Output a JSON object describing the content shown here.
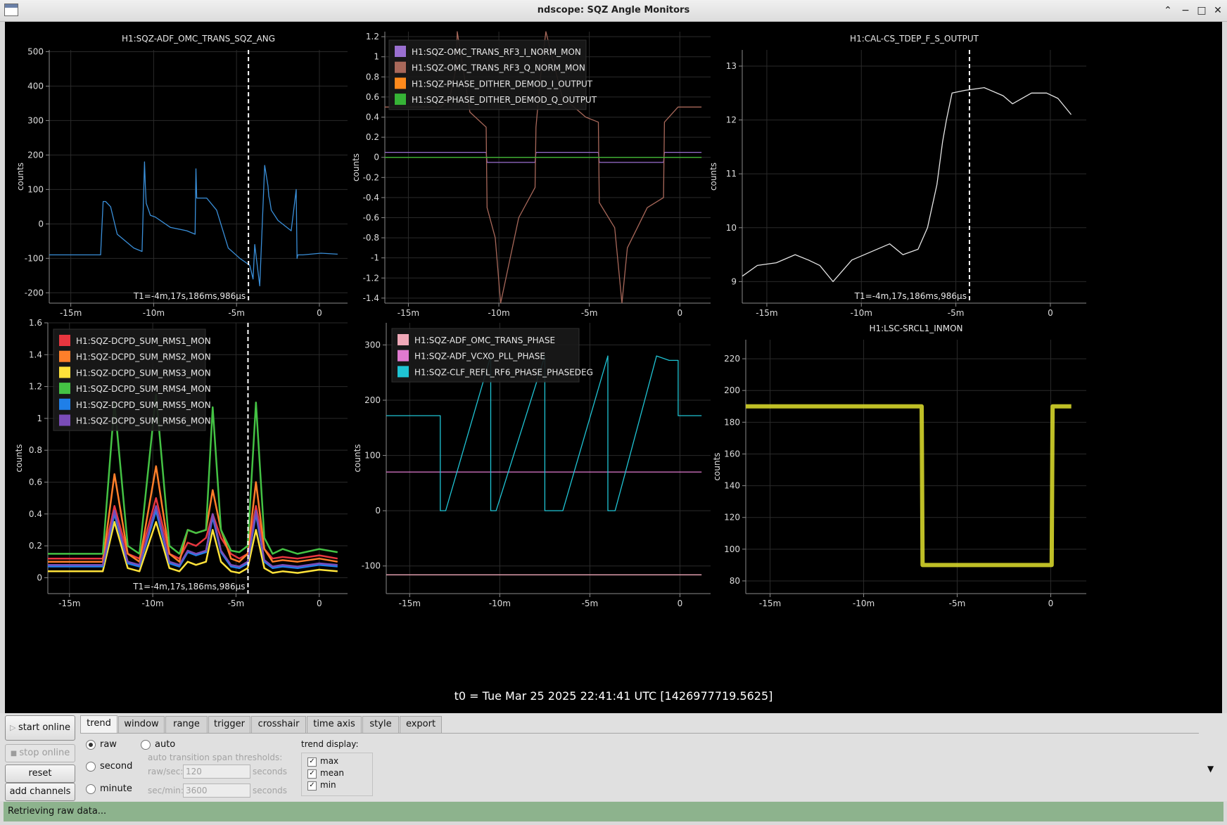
{
  "window": {
    "title": "ndscope: SQZ Angle Monitors"
  },
  "colors": {
    "bg": "#000000",
    "grid": "#2a2a2a",
    "axis": "#8a8a8a",
    "cursor": "#ffffff"
  },
  "t0": "t0 = Tue Mar 25 2025 22:41:41 UTC [1426977719.5625]",
  "cursor_label": "T1=-4m,17s,186ms,986µs",
  "plots": [
    {
      "id": "p1",
      "title": "H1:SQZ-ADF_OMC_TRANS_SQZ_ANG",
      "ylabel": "counts",
      "yticks": [
        "500",
        "400",
        "300",
        "200",
        "100",
        "0",
        "-100",
        "-200"
      ],
      "xticks": [
        "-15m",
        "-10m",
        "-5m",
        "0"
      ],
      "legend": [],
      "cursor_label": "T1=-4m,17s,186ms,986µs"
    },
    {
      "id": "p2",
      "title": "",
      "ylabel": "counts",
      "yticks": [
        "1.2",
        "1",
        "0.8",
        "0.6",
        "0.4",
        "0.2",
        "0",
        "-0.2",
        "-0.4",
        "-0.6",
        "-0.8",
        "-1",
        "-1.2",
        "-1.4"
      ],
      "xticks": [
        "-15m",
        "-10m",
        "-5m",
        "0"
      ],
      "legend": [
        {
          "name": "H1:SQZ-OMC_TRANS_RF3_I_NORM_MON",
          "color": "#9a6fd0"
        },
        {
          "name": "H1:SQZ-OMC_TRANS_RF3_Q_NORM_MON",
          "color": "#a8685a"
        },
        {
          "name": "H1:SQZ-PHASE_DITHER_DEMOD_I_OUTPUT",
          "color": "#ff8a1c"
        },
        {
          "name": "H1:SQZ-PHASE_DITHER_DEMOD_Q_OUTPUT",
          "color": "#36b336"
        }
      ],
      "cursor_label": ""
    },
    {
      "id": "p3",
      "title": "H1:CAL-CS_TDEP_F_S_OUTPUT",
      "ylabel": "counts",
      "yticks": [
        "13",
        "12",
        "11",
        "10",
        "9"
      ],
      "xticks": [
        "-15m",
        "-10m",
        "-5m",
        "0"
      ],
      "legend": [],
      "cursor_label": "T1=-4m,17s,186ms,986µs"
    },
    {
      "id": "p4",
      "title": "",
      "ylabel": "counts",
      "yticks": [
        "1.6",
        "1.4",
        "1.2",
        "1",
        "0.8",
        "0.6",
        "0.4",
        "0.2",
        "0"
      ],
      "xticks": [
        "-15m",
        "-10m",
        "-5m",
        "0"
      ],
      "legend": [
        {
          "name": "H1:SQZ-DCPD_SUM_RMS1_MON",
          "color": "#e8363f"
        },
        {
          "name": "H1:SQZ-DCPD_SUM_RMS2_MON",
          "color": "#ff7f2a"
        },
        {
          "name": "H1:SQZ-DCPD_SUM_RMS3_MON",
          "color": "#ffe23a"
        },
        {
          "name": "H1:SQZ-DCPD_SUM_RMS4_MON",
          "color": "#44c244"
        },
        {
          "name": "H1:SQZ-DCPD_SUM_RMS5_MON",
          "color": "#1f7fe8"
        },
        {
          "name": "H1:SQZ-DCPD_SUM_RMS6_MON",
          "color": "#7a4cb8"
        }
      ],
      "cursor_label": "T1=-4m,17s,186ms,986µs"
    },
    {
      "id": "p5",
      "title": "",
      "ylabel": "counts",
      "yticks": [
        "300",
        "200",
        "100",
        "0",
        "-100"
      ],
      "xticks": [
        "-15m",
        "-10m",
        "-5m",
        "0"
      ],
      "legend": [
        {
          "name": "H1:SQZ-ADF_OMC_TRANS_PHASE",
          "color": "#f0a8b8"
        },
        {
          "name": "H1:SQZ-ADF_VCXO_PLL_PHASE",
          "color": "#e07ad0"
        },
        {
          "name": "H1:SQZ-CLF_REFL_RF6_PHASE_PHASEDEG",
          "color": "#1fc4d4"
        }
      ],
      "cursor_label": ""
    },
    {
      "id": "p6",
      "title": "H1:LSC-SRCL1_INMON",
      "ylabel": "counts",
      "yticks": [
        "220",
        "200",
        "180",
        "160",
        "140",
        "120",
        "100",
        "80"
      ],
      "xticks": [
        "-15m",
        "-10m",
        "-5m",
        "0"
      ],
      "legend": [],
      "cursor_label": ""
    }
  ],
  "chart_data": [
    {
      "type": "line",
      "title": "H1:SQZ-ADF_OMC_TRANS_SQZ_ANG",
      "ylabel": "counts",
      "xlabel": "",
      "xlim": [
        -16.3,
        1.7
      ],
      "ylim": [
        -230,
        505
      ],
      "series": [
        {
          "color": "#3a8fd9",
          "x": [
            -16.3,
            -13.2,
            -13.05,
            -12.9,
            -12.6,
            -12.2,
            -11.2,
            -10.7,
            -10.55,
            -10.5,
            -10.45,
            -10.3,
            -10.2,
            -9.9,
            -9.0,
            -8.0,
            -7.5,
            -7.45,
            -7.4,
            -7.3,
            -6.8,
            -6.2,
            -5.5,
            -4.8,
            -4.2,
            -4.0,
            -3.9,
            -3.8,
            -3.6,
            -3.3,
            -3.1,
            -3.05,
            -3.0,
            -2.9,
            -2.5,
            -1.7,
            -1.4,
            -1.35,
            -1.3,
            -1.0,
            0.1,
            1.1
          ],
          "y": [
            -90,
            -90,
            65,
            65,
            50,
            -30,
            -70,
            -80,
            180,
            110,
            60,
            40,
            25,
            20,
            -10,
            -20,
            -30,
            160,
            75,
            75,
            75,
            40,
            -70,
            -100,
            -120,
            -160,
            -60,
            -100,
            -180,
            170,
            110,
            80,
            70,
            40,
            10,
            -20,
            100,
            -100,
            -90,
            -90,
            -85,
            -88
          ]
        }
      ]
    },
    {
      "type": "line",
      "title": "",
      "ylabel": "counts",
      "xlabel": "",
      "xlim": [
        -16.3,
        1.7
      ],
      "ylim": [
        -1.45,
        1.25
      ],
      "series": [
        {
          "name": "H1:SQZ-OMC_TRANS_RF3_I_NORM_MON",
          "color": "#9a6fd0",
          "x": [
            -16.3,
            -10.7,
            -10.65,
            -8.0,
            -7.95,
            -4.5,
            -4.45,
            -0.9,
            -0.85,
            1.2
          ],
          "y": [
            0.05,
            0.05,
            -0.05,
            -0.05,
            0.05,
            0.05,
            -0.05,
            -0.05,
            0.05,
            0.05
          ]
        },
        {
          "name": "H1:SQZ-OMC_TRANS_RF3_Q_NORM_MON",
          "color": "#a8685a",
          "x": [
            -16.3,
            -13.2,
            -12.7,
            -12.35,
            -12.3,
            -11.6,
            -10.7,
            -10.65,
            -10.2,
            -9.9,
            -8.9,
            -8.0,
            -7.95,
            -7.7,
            -7.4,
            -6.5,
            -5.2,
            -4.5,
            -4.45,
            -3.6,
            -3.2,
            -2.9,
            -1.8,
            -0.9,
            -0.85,
            -0.1,
            1.2
          ],
          "y": [
            0.5,
            0.5,
            0.6,
            0.9,
            1.25,
            0.45,
            0.3,
            -0.5,
            -0.8,
            -1.45,
            -0.6,
            -0.3,
            0.3,
            0.8,
            1.25,
            0.6,
            0.4,
            0.35,
            -0.45,
            -0.7,
            -1.45,
            -0.9,
            -0.5,
            -0.4,
            0.35,
            0.5,
            0.5
          ]
        },
        {
          "name": "H1:SQZ-PHASE_DITHER_DEMOD_I_OUTPUT",
          "color": "#ff8a1c",
          "x": [
            -16.3,
            1.2
          ],
          "y": [
            0,
            0
          ]
        },
        {
          "name": "H1:SQZ-PHASE_DITHER_DEMOD_Q_OUTPUT",
          "color": "#36b336",
          "x": [
            -16.3,
            1.2
          ],
          "y": [
            0,
            0
          ]
        }
      ]
    },
    {
      "type": "line",
      "title": "H1:CAL-CS_TDEP_F_S_OUTPUT",
      "ylabel": "counts",
      "xlabel": "",
      "xlim": [
        -16.3,
        1.9
      ],
      "ylim": [
        8.6,
        13.3
      ],
      "series": [
        {
          "color": "#e6e6e6",
          "x": [
            -16.3,
            -15.5,
            -14.5,
            -13.5,
            -12.8,
            -12.2,
            -11.5,
            -10.5,
            -9.5,
            -8.5,
            -7.8,
            -7.0,
            -6.5,
            -6.0,
            -5.7,
            -5.5,
            -5.2,
            -4.5,
            -3.5,
            -2.5,
            -2.0,
            -1.0,
            -0.2,
            0.4,
            1.1
          ],
          "y": [
            9.1,
            9.3,
            9.35,
            9.5,
            9.4,
            9.3,
            9.0,
            9.4,
            9.55,
            9.7,
            9.5,
            9.6,
            10.0,
            10.8,
            11.6,
            12.0,
            12.5,
            12.55,
            12.6,
            12.45,
            12.3,
            12.5,
            12.5,
            12.4,
            12.1
          ]
        }
      ]
    },
    {
      "type": "line",
      "title": "",
      "ylabel": "counts",
      "xlabel": "",
      "xlim": [
        -16.3,
        1.7
      ],
      "ylim": [
        -0.1,
        1.6
      ],
      "series": [
        {
          "name": "H1:SQZ-DCPD_SUM_RMS1_MON",
          "color": "#e8363f",
          "x": [
            -16.3,
            -13,
            -12.3,
            -11.5,
            -10.8,
            -9.8,
            -9.0,
            -8.4,
            -7.9,
            -7.4,
            -6.8,
            -6.4,
            -5.9,
            -5.3,
            -4.8,
            -4.3,
            -3.8,
            -3.3,
            -2.8,
            -2.2,
            -1.3,
            0,
            1.1
          ],
          "y": [
            0.12,
            0.12,
            0.45,
            0.15,
            0.12,
            0.5,
            0.15,
            0.12,
            0.22,
            0.2,
            0.25,
            0.4,
            0.25,
            0.15,
            0.12,
            0.15,
            0.45,
            0.18,
            0.12,
            0.13,
            0.12,
            0.14,
            0.12
          ]
        },
        {
          "name": "H1:SQZ-DCPD_SUM_RMS2_MON",
          "color": "#ff7f2a",
          "x": [
            -16.3,
            -13,
            -12.3,
            -11.5,
            -10.8,
            -9.8,
            -9.0,
            -8.4,
            -7.9,
            -7.4,
            -6.8,
            -6.4,
            -5.9,
            -5.3,
            -4.8,
            -4.3,
            -3.8,
            -3.3,
            -2.8,
            -2.2,
            -1.3,
            0,
            1.1
          ],
          "y": [
            0.1,
            0.1,
            0.65,
            0.15,
            0.1,
            0.7,
            0.15,
            0.1,
            0.3,
            0.28,
            0.3,
            0.55,
            0.3,
            0.12,
            0.1,
            0.15,
            0.6,
            0.18,
            0.1,
            0.11,
            0.1,
            0.12,
            0.1
          ]
        },
        {
          "name": "H1:SQZ-DCPD_SUM_RMS3_MON",
          "color": "#ffe23a",
          "x": [
            -16.3,
            -13,
            -12.3,
            -11.5,
            -10.8,
            -9.8,
            -9.0,
            -8.4,
            -7.9,
            -7.4,
            -6.8,
            -6.4,
            -5.9,
            -5.3,
            -4.8,
            -4.3,
            -3.8,
            -3.3,
            -2.8,
            -2.2,
            -1.3,
            0,
            1.1
          ],
          "y": [
            0.04,
            0.04,
            0.35,
            0.06,
            0.04,
            0.35,
            0.06,
            0.04,
            0.1,
            0.08,
            0.1,
            0.3,
            0.1,
            0.04,
            0.03,
            0.06,
            0.3,
            0.06,
            0.03,
            0.04,
            0.03,
            0.05,
            0.04
          ]
        },
        {
          "name": "H1:SQZ-DCPD_SUM_RMS4_MON",
          "color": "#44c244",
          "x": [
            -16.3,
            -13,
            -12.3,
            -11.5,
            -10.8,
            -9.8,
            -9.0,
            -8.4,
            -7.9,
            -7.4,
            -6.8,
            -6.4,
            -5.9,
            -5.3,
            -4.8,
            -4.3,
            -3.8,
            -3.3,
            -2.8,
            -2.2,
            -1.3,
            0,
            1.1
          ],
          "y": [
            0.15,
            0.15,
            1.1,
            0.2,
            0.15,
            1.15,
            0.2,
            0.15,
            0.3,
            0.28,
            0.3,
            1.07,
            0.3,
            0.17,
            0.16,
            0.2,
            1.1,
            0.25,
            0.15,
            0.18,
            0.15,
            0.18,
            0.16
          ]
        },
        {
          "name": "H1:SQZ-DCPD_SUM_RMS5_MON",
          "color": "#1f7fe8",
          "x": [
            -16.3,
            -13,
            -12.3,
            -11.5,
            -10.8,
            -9.8,
            -9.0,
            -8.4,
            -7.9,
            -7.4,
            -6.8,
            -6.4,
            -5.9,
            -5.3,
            -4.8,
            -4.3,
            -3.8,
            -3.3,
            -2.8,
            -2.2,
            -1.3,
            0,
            1.1
          ],
          "y": [
            0.07,
            0.07,
            0.4,
            0.09,
            0.07,
            0.42,
            0.09,
            0.07,
            0.16,
            0.14,
            0.16,
            0.38,
            0.16,
            0.07,
            0.06,
            0.09,
            0.4,
            0.1,
            0.06,
            0.07,
            0.06,
            0.08,
            0.07
          ]
        },
        {
          "name": "H1:SQZ-DCPD_SUM_RMS6_MON",
          "color": "#7a4cb8",
          "x": [
            -16.3,
            -13,
            -12.3,
            -11.5,
            -10.8,
            -9.8,
            -9.0,
            -8.4,
            -7.9,
            -7.4,
            -6.8,
            -6.4,
            -5.9,
            -5.3,
            -4.8,
            -4.3,
            -3.8,
            -3.3,
            -2.8,
            -2.2,
            -1.3,
            0,
            1.1
          ],
          "y": [
            0.08,
            0.08,
            0.42,
            0.1,
            0.08,
            0.45,
            0.1,
            0.08,
            0.17,
            0.15,
            0.17,
            0.4,
            0.17,
            0.08,
            0.07,
            0.1,
            0.42,
            0.11,
            0.07,
            0.08,
            0.07,
            0.09,
            0.08
          ]
        }
      ]
    },
    {
      "type": "line",
      "title": "",
      "ylabel": "counts",
      "xlabel": "",
      "xlim": [
        -16.3,
        1.7
      ],
      "ylim": [
        -150,
        340
      ],
      "series": [
        {
          "name": "H1:SQZ-ADF_OMC_TRANS_PHASE",
          "color": "#f0a8b8",
          "x": [
            -16.3,
            1.2
          ],
          "y": [
            -116,
            -116
          ]
        },
        {
          "name": "H1:SQZ-ADF_VCXO_PLL_PHASE",
          "color": "#e07ad0",
          "x": [
            -16.3,
            1.2
          ],
          "y": [
            70,
            70
          ]
        },
        {
          "name": "H1:SQZ-CLF_REFL_RF6_PHASE_PHASEDEG",
          "color": "#1fc4d4",
          "x": [
            -16.3,
            -13.3,
            -13.3,
            -13.0,
            -10.5,
            -10.5,
            -10.2,
            -7.5,
            -7.5,
            -6.5,
            -4.0,
            -4.0,
            -3.6,
            -1.3,
            -0.6,
            -0.1,
            -0.1,
            1.2
          ],
          "y": [
            172,
            172,
            0,
            0,
            280,
            0,
            0,
            280,
            0,
            0,
            280,
            0,
            0,
            280,
            272,
            272,
            172,
            172
          ]
        }
      ]
    },
    {
      "type": "line",
      "title": "H1:LSC-SRCL1_INMON",
      "ylabel": "counts",
      "xlabel": "",
      "xlim": [
        -16.3,
        1.9
      ],
      "ylim": [
        72,
        232
      ],
      "series": [
        {
          "color": "#d4d42a",
          "x": [
            -16.3,
            -6.9,
            -6.85,
            0.05,
            0.1,
            1.1
          ],
          "y": [
            190,
            190,
            90,
            90,
            190,
            190
          ]
        }
      ]
    }
  ],
  "controls": {
    "buttons": {
      "start_online": "start online",
      "stop_online": "stop online",
      "reset": "reset",
      "add_channels": "add channels"
    },
    "tabs": [
      "trend",
      "window",
      "range",
      "trigger",
      "crosshair",
      "time axis",
      "style",
      "export"
    ],
    "trend": {
      "raw": "raw",
      "second": "second",
      "minute": "minute",
      "auto": "auto",
      "thresholds_title": "auto transition span thresholds:",
      "raw_sec_label": "raw/sec:",
      "raw_sec_value": "120",
      "sec_min_label": "sec/min:",
      "sec_min_value": "3600",
      "unit": "seconds",
      "display_title": "trend display:",
      "display_max": "max",
      "display_mean": "mean",
      "display_min": "min"
    },
    "arrow": "▼"
  },
  "status": "Retrieving raw data..."
}
